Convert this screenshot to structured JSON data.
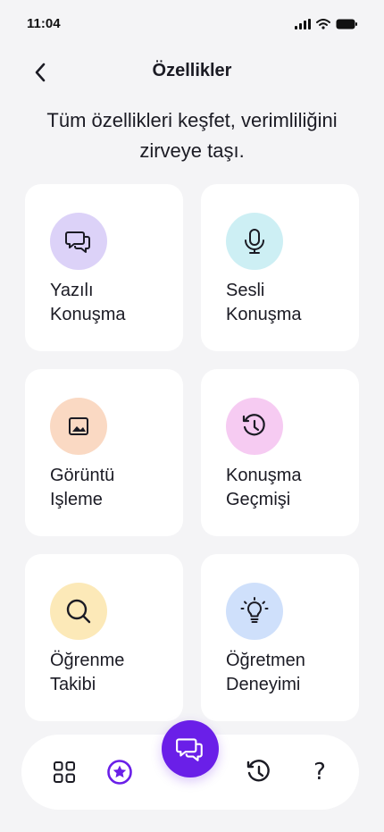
{
  "status_bar": {
    "time": "11:04"
  },
  "header": {
    "title": "Özellikler"
  },
  "subtitle": "Tüm özellikleri keşfet, verimliliğini zirveye taşı.",
  "features": [
    {
      "label_line1": "Yazılı",
      "label_line2": "Konuşma",
      "icon": "chat-bubbles-icon",
      "icon_bg": "#DCD2F8"
    },
    {
      "label_line1": "Sesli",
      "label_line2": "Konuşma",
      "icon": "microphone-icon",
      "icon_bg": "#CDEFF4"
    },
    {
      "label_line1": "Görüntü",
      "label_line2": "Işleme",
      "icon": "image-icon",
      "icon_bg": "#FAD9C3"
    },
    {
      "label_line1": "Konuşma",
      "label_line2": "Geçmişi",
      "icon": "history-icon",
      "icon_bg": "#F6CBF2"
    },
    {
      "label_line1": "Öğrenme",
      "label_line2": "Takibi",
      "icon": "search-icon",
      "icon_bg": "#FCE9B8"
    },
    {
      "label_line1": "Öğretmen",
      "label_line2": "Deneyimi",
      "icon": "lightbulb-icon",
      "icon_bg": "#CFE0FB"
    }
  ],
  "bottom_nav": {
    "items": [
      "apps-grid-icon",
      "star-badge-icon",
      "chat-fab-icon",
      "history-icon",
      "help-icon"
    ],
    "help_glyph": "?",
    "accent": "#6A1FE8"
  }
}
